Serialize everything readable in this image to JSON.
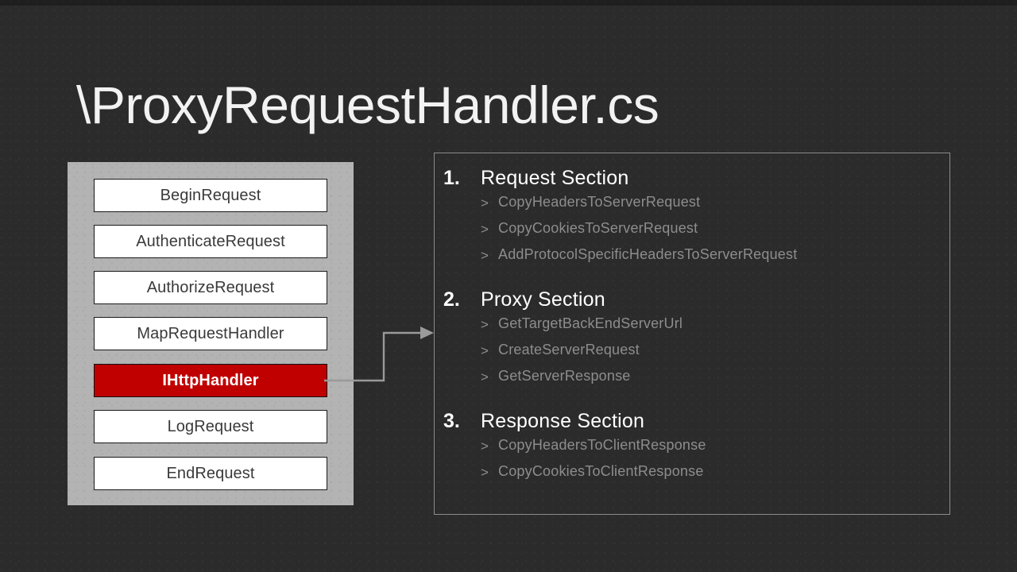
{
  "slide": {
    "title": "\\ProxyRequestHandler.cs",
    "background_color": "#2b2b2b",
    "accent_color": "#c00000",
    "panel_color": "#b3b3b3",
    "muted_text_color": "#8d8d8d"
  },
  "pipeline": {
    "name": "ASP.NET request pipeline",
    "stages": [
      {
        "label": "BeginRequest",
        "highlighted": false
      },
      {
        "label": "AuthenticateRequest",
        "highlighted": false
      },
      {
        "label": "AuthorizeRequest",
        "highlighted": false
      },
      {
        "label": "MapRequestHandler",
        "highlighted": false
      },
      {
        "label": "IHttpHandler",
        "highlighted": true
      },
      {
        "label": "LogRequest",
        "highlighted": false
      },
      {
        "label": "EndRequest",
        "highlighted": false
      }
    ]
  },
  "connector": {
    "from": "IHttpHandler",
    "to": "details-panel",
    "color": "#9a9a9a"
  },
  "details": {
    "sections": [
      {
        "number": "1.",
        "title": "Request Section",
        "items": [
          {
            "marker": ">",
            "label": "CopyHeadersToServerRequest"
          },
          {
            "marker": ">",
            "label": "CopyCookiesToServerRequest"
          },
          {
            "marker": ">",
            "label": "AddProtocolSpecificHeadersToServerRequest"
          }
        ]
      },
      {
        "number": "2.",
        "title": "Proxy Section",
        "items": [
          {
            "marker": ">",
            "label": "GetTargetBackEndServerUrl"
          },
          {
            "marker": ">",
            "label": "CreateServerRequest"
          },
          {
            "marker": ">",
            "label": "GetServerResponse"
          }
        ]
      },
      {
        "number": "3.",
        "title": "Response Section",
        "items": [
          {
            "marker": ">",
            "label": "CopyHeadersToClientResponse"
          },
          {
            "marker": ">",
            "label": "CopyCookiesToClientResponse"
          }
        ]
      }
    ]
  }
}
